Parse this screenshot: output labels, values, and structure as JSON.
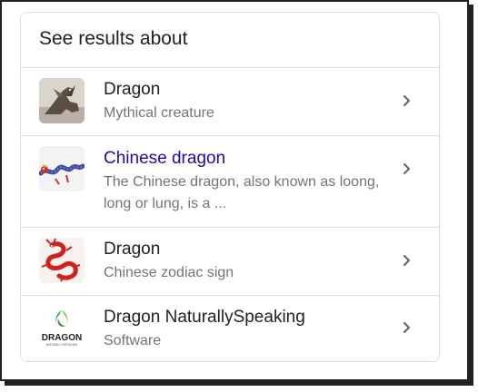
{
  "card": {
    "title": "See results about"
  },
  "items": [
    {
      "title": "Dragon",
      "subtitle": "Mythical creature",
      "thumbnail": "dragon-statue-thumbnail",
      "title_is_link": false
    },
    {
      "title": "Chinese dragon",
      "subtitle": "The Chinese dragon, also known as loong, long or lung, is a ...",
      "thumbnail": "chinese-dragon-thumbnail",
      "title_is_link": true
    },
    {
      "title": "Dragon",
      "subtitle": "Chinese zodiac sign",
      "thumbnail": "red-dragon-thumbnail",
      "title_is_link": false
    },
    {
      "title": "Dragon NaturallySpeaking",
      "subtitle": "Software",
      "thumbnail": "dragon-naturallyspeaking-logo",
      "title_is_link": false,
      "logo_text": "DRAGON",
      "logo_subtext": "NATURALLYSPEAKING"
    }
  ],
  "colors": {
    "link": "#1a0dab",
    "title": "#202124",
    "subtitle": "#70757a",
    "divider": "#dadce0",
    "logo_green": "#3aa845"
  },
  "icons": {
    "row_action": "chevron-right-icon"
  }
}
